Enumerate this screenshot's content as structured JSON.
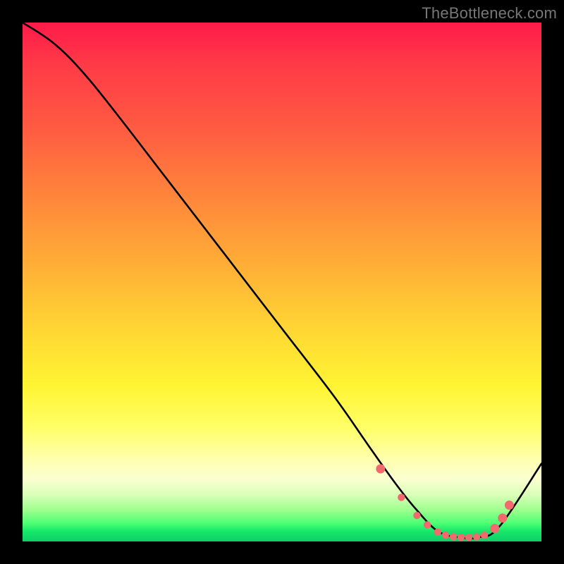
{
  "watermark": "TheBottleneck.com",
  "chart_data": {
    "type": "line",
    "title": "",
    "xlabel": "",
    "ylabel": "",
    "xlim": [
      0,
      100
    ],
    "ylim": [
      0,
      100
    ],
    "series": [
      {
        "name": "bottleneck-curve",
        "x": [
          0,
          6,
          12,
          20,
          30,
          40,
          50,
          60,
          67,
          72,
          76,
          80,
          84,
          88,
          92,
          100
        ],
        "y": [
          100,
          96,
          90,
          80,
          67,
          54,
          41,
          28,
          18,
          11,
          6,
          2,
          0.8,
          0.8,
          3,
          15
        ]
      }
    ],
    "markers": {
      "name": "highlight-points",
      "color": "#f06a6e",
      "x": [
        69,
        73,
        76,
        78,
        80,
        81.5,
        83,
        84.5,
        86,
        87.5,
        89,
        91,
        92.5,
        93.8
      ],
      "y": [
        14,
        8.5,
        5,
        3.2,
        1.8,
        1.2,
        0.9,
        0.8,
        0.8,
        0.9,
        1.2,
        2.5,
        4.5,
        7
      ]
    }
  }
}
